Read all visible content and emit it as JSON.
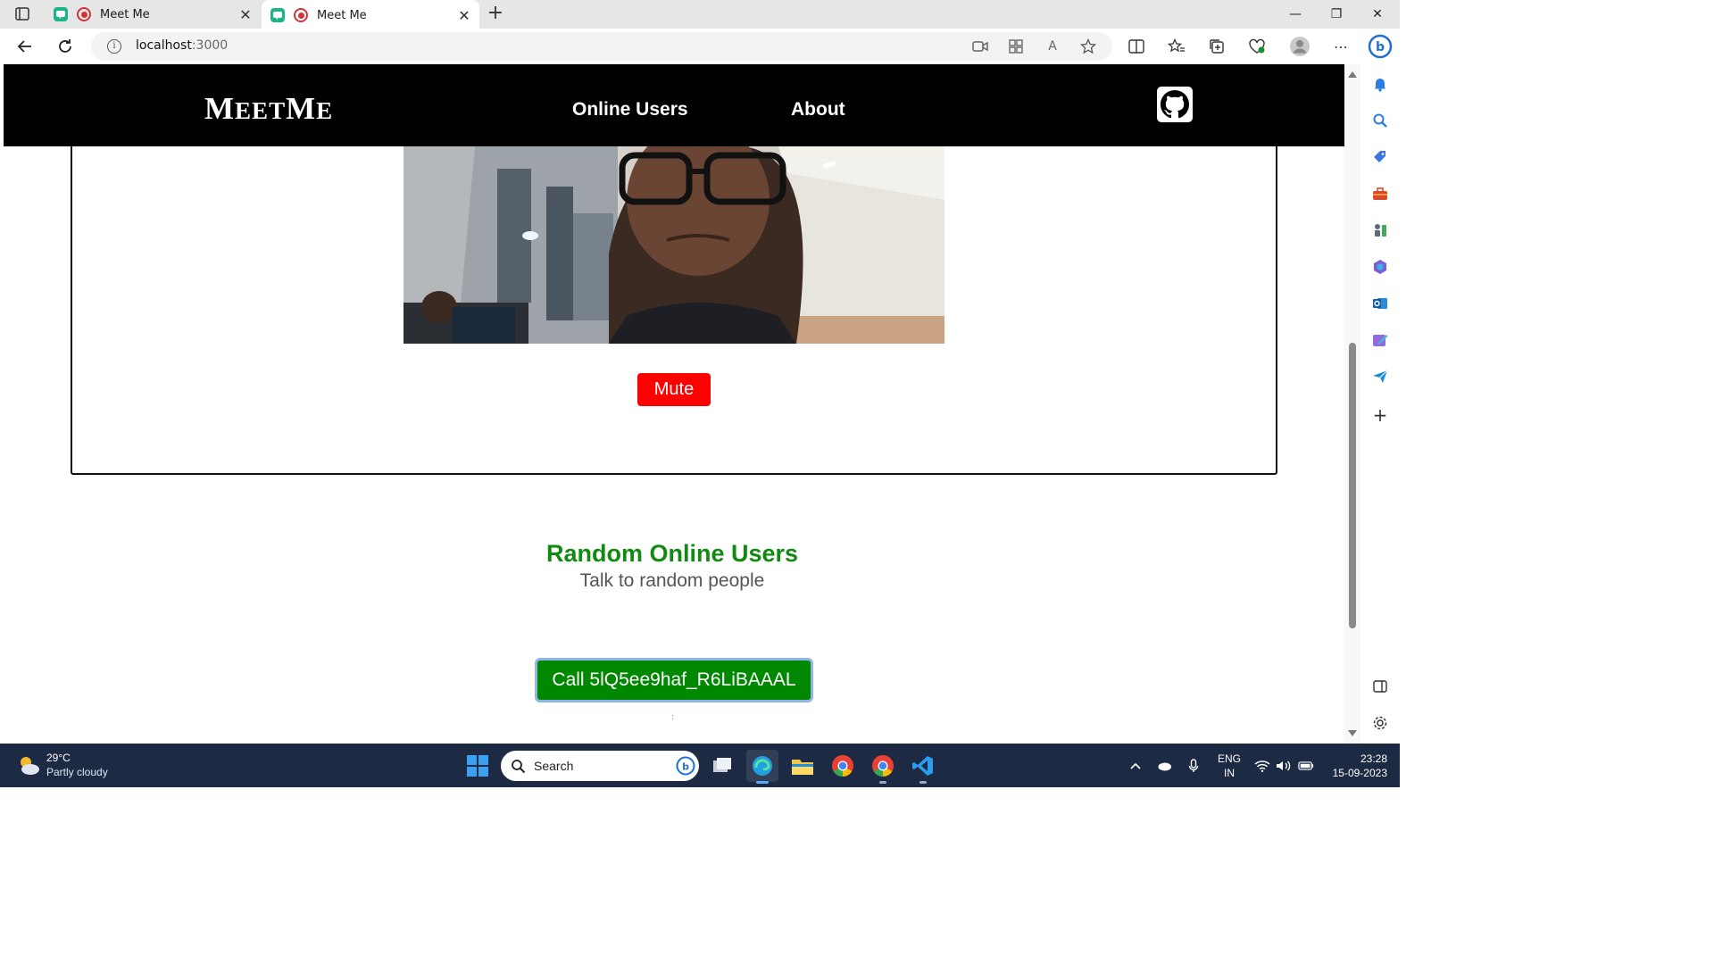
{
  "browser": {
    "tabs": [
      {
        "title": "Meet Me",
        "active": false
      },
      {
        "title": "Meet Me",
        "active": true
      }
    ],
    "address": {
      "host": "localhost",
      "port": ":3000"
    }
  },
  "app": {
    "brand": {
      "first_big": "M",
      "first_small": "EET",
      "second_big": "M",
      "second_small": "E"
    },
    "nav": {
      "online_users": "Online Users",
      "about": "About"
    },
    "video_controls": {
      "mute_label": "Mute"
    },
    "random_section": {
      "title": "Random Online Users",
      "subtitle": "Talk to random people",
      "call_button": "Call 5lQ5ee9haf_R6LiBAAAL",
      "mark": ":"
    },
    "colors": {
      "navbar": "#000000",
      "mute": "#ff0000",
      "call": "#008800",
      "section_title": "#118a11"
    }
  },
  "taskbar": {
    "weather": {
      "temp": "29°C",
      "condition": "Partly cloudy"
    },
    "search_label": "Search",
    "language": {
      "line1": "ENG",
      "line2": "IN"
    },
    "clock": {
      "time": "23:28",
      "date": "15-09-2023"
    }
  }
}
